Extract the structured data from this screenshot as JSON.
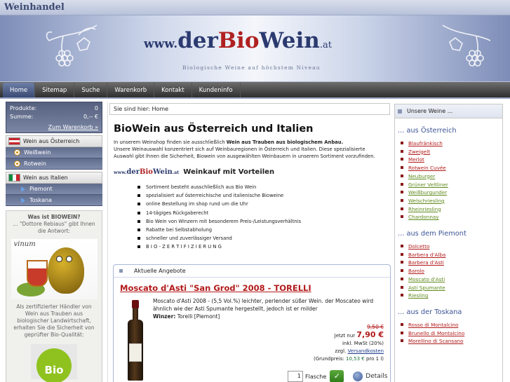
{
  "header": {
    "brand_tag": "Weinhandel",
    "logo_www": "www.",
    "logo_der": "der",
    "logo_bio": "Bio",
    "logo_wein": "Wein",
    "logo_tld": ".at",
    "tagline": "Biologische Weine auf höchstem Niveau"
  },
  "nav": {
    "items": [
      "Home",
      "Sitemap",
      "Suche",
      "Warenkorb",
      "Kontakt",
      "Kundeninfo"
    ]
  },
  "cart": {
    "products_label": "Produkte:",
    "products_value": "0",
    "sum_label": "Summe:",
    "sum_value": "0,-- €",
    "link": "Zum Warenkorb »"
  },
  "categories": {
    "austria": "Wein aus Österreich",
    "austria_sub": [
      "Weißwein",
      "Rotwein"
    ],
    "italy": "Wein aus Italien",
    "italy_sub": [
      "Piemont",
      "Toskana"
    ]
  },
  "info": {
    "question": "Was ist BIOWEIN?",
    "answer": "... \"Dottore Rebiaus\" gibt Ihnen die Antwort:",
    "image_label": "vinum",
    "cert_text": "Als zertifizierter Händler von Wein aus Trauben aus biologischer Landwirtschaft, erhalten Sie die Sicherheit von geprüfter Bio-Qualität:",
    "badge": "Bio"
  },
  "main": {
    "breadcrumb": "Sie sind hier: Home",
    "title": "BioWein aus Österreich und Italien",
    "intro_1": "In unserem Weinshop finden sie ausschließlich",
    "intro_bold": "Wein aus Trauben aus biologischem Anbau.",
    "intro_2": "Unsere Weinauswahl konzentriert sich auf Weinbauregionen in Österreich und Italien. Diese spezialisierte Auswahl gibt Ihnen die Sicherheit, Biowein von ausgewählten Weinbauern in unserem Sortiment vorzufinden.",
    "vorteile_title": "Weinkauf mit Vorteilen",
    "bullets": [
      "Sortiment besteht ausschließlich aus Bio Wein",
      "spezialisiert auf österreichische und italienische Bioweine",
      "online Bestellung im shop rund um die Uhr",
      "14-tägiges Rückgaberecht",
      "Bio Wein von Winzern mit besonderem Preis-/Leistungsverhältnis",
      "Rabatte bei Selbstabholung",
      "schneller und zuverlässiger Versand",
      "B I O - Z E R T I F I Z I E R U N G"
    ]
  },
  "offers": {
    "head": "Aktuelle Angebote",
    "wine_title": "Moscato d'Asti \"San Grod\" 2008 - TORELLI",
    "desc": "Moscato d'Asti 2008 - (5,5 Vol.%) leichter, perlender süßer Wein. der Moscateo wird ähnlich wie der Asti Spumante hergestellt, jedoch ist er milder",
    "winzer_label": "Winzer:",
    "winzer_value": "Torelli [Piemont]",
    "old_price": "9,50 €",
    "now_label": "Jetzt nur",
    "new_price": "7,90 €",
    "vat": "inkl. MwSt (20%)",
    "ship_prefix": "zzgl.",
    "ship_link": "Versandkosten",
    "base_price_label": "(Grundpreis:",
    "base_price_value": "10,53 €",
    "base_price_suffix": "pro 1 l)",
    "qty": "1",
    "qty_unit": "Flasche",
    "details": "Details"
  },
  "right": {
    "head": "Unsere Weine ...",
    "regions": [
      {
        "title": "... aus Österreich",
        "wines": [
          {
            "name": "Blaufränkisch",
            "kind": "red"
          },
          {
            "name": "Zweigelt",
            "kind": "red"
          },
          {
            "name": "Merlot",
            "kind": "red"
          },
          {
            "name": "Rotwein Cuvée",
            "kind": "red"
          },
          {
            "name": "Neuburger",
            "kind": "grn"
          },
          {
            "name": "Grüner Veltliner",
            "kind": "grn"
          },
          {
            "name": "Weißburgunder",
            "kind": "grn"
          },
          {
            "name": "Welschriesling",
            "kind": "grn"
          },
          {
            "name": "Rheinriesling",
            "kind": "grn"
          },
          {
            "name": "Chardonnay",
            "kind": "grn"
          }
        ]
      },
      {
        "title": "... aus dem Piemont",
        "wines": [
          {
            "name": "Dolcetto",
            "kind": "red"
          },
          {
            "name": "Barbera d'Alba",
            "kind": "red"
          },
          {
            "name": "Barbera d'Asti",
            "kind": "red"
          },
          {
            "name": "Barolo",
            "kind": "red"
          },
          {
            "name": "Moscato d'Asti",
            "kind": "grn"
          },
          {
            "name": "Asti Spumante",
            "kind": "grn"
          },
          {
            "name": "Riesling",
            "kind": "grn"
          }
        ]
      },
      {
        "title": "... aus der Toskana",
        "wines": [
          {
            "name": "Rosso di Montalcino",
            "kind": "red"
          },
          {
            "name": "Brunello di Montalcino",
            "kind": "red"
          },
          {
            "name": "Morellino di Scansano",
            "kind": "red"
          }
        ]
      }
    ]
  }
}
